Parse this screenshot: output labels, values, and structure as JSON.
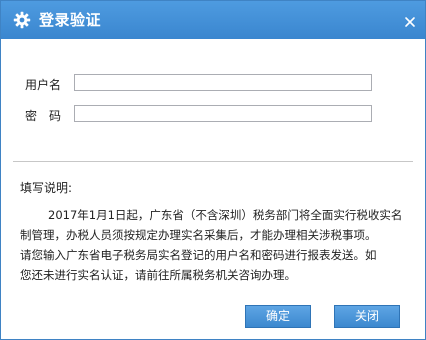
{
  "dialog": {
    "title": "登录验证",
    "title_icon": "gear-icon",
    "close_icon": "close-icon"
  },
  "form": {
    "username_label": "用户名",
    "username_value": "",
    "password_label": "密　码",
    "password_value": ""
  },
  "notes": {
    "title": "填写说明:",
    "lines": [
      "2017年1月1日起，广东省（不含深圳）税务部门将全面实行税收实名",
      "制管理，办税人员须按规定办理实名采集后，才能办理相关涉税事项。",
      "请您输入广东省电子税务局实名登记的用户名和密码进行报表发送。如",
      "您还未进行实名认证，请前往所属税务机关咨询办理。"
    ]
  },
  "buttons": {
    "ok_label": "确定",
    "close_label": "关闭"
  },
  "colors": {
    "titlebar": "#3a86cf",
    "button": "#4a94d8"
  }
}
